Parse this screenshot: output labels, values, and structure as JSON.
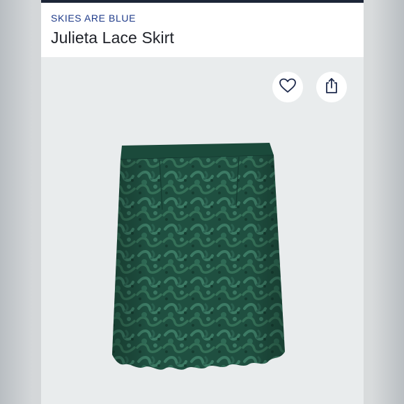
{
  "header": {
    "brand": "SKIES ARE BLUE",
    "title": "Julieta Lace Skirt"
  },
  "actions": {
    "favorite_icon": "heart-outline",
    "share_icon": "share-up-arrow"
  },
  "product_image": {
    "description_color": "#1e4f3f"
  },
  "colors": {
    "brand_blue": "#1f3b8a",
    "title_text": "#1f2229",
    "image_background": "#e9eced",
    "top_strip": "#1c2537",
    "skirt_green": "#2a5c4b"
  }
}
